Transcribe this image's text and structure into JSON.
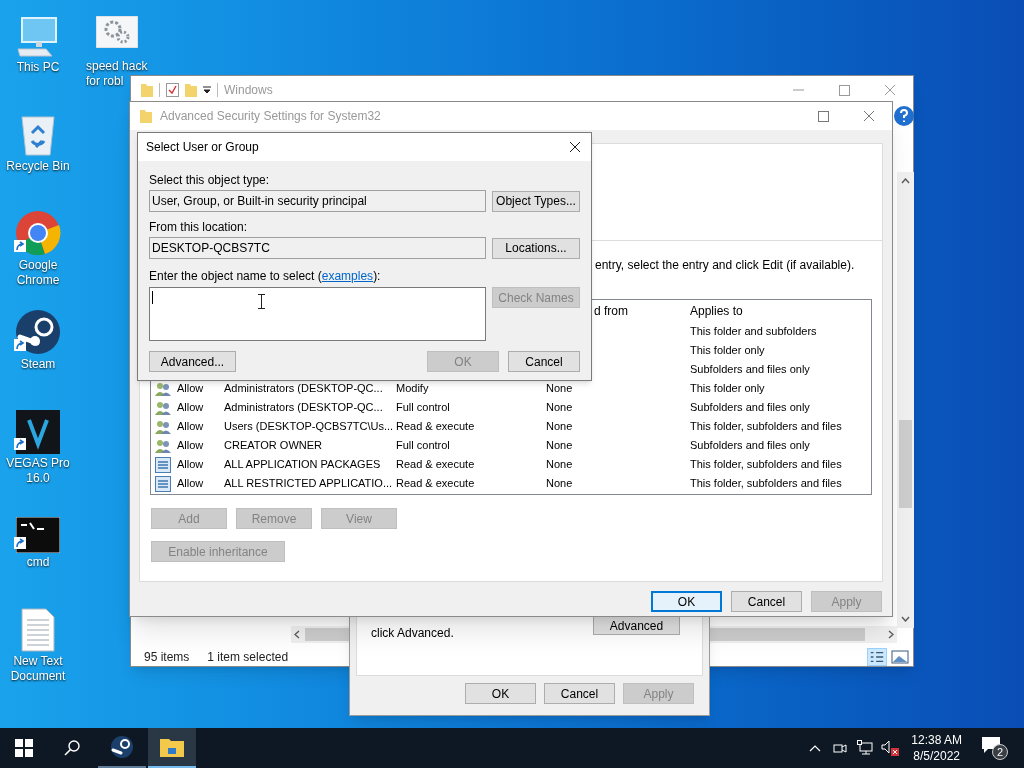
{
  "desktop": {
    "icons": [
      {
        "label": "This PC",
        "kind": "pc"
      },
      {
        "label": "Recycle Bin",
        "kind": "recycle"
      },
      {
        "label": "Google Chrome",
        "kind": "chrome",
        "shortcut": true
      },
      {
        "label": "Steam",
        "kind": "steam",
        "shortcut": true
      },
      {
        "label": "VEGAS Pro 16.0",
        "kind": "vegas",
        "shortcut": true
      },
      {
        "label": "cmd",
        "kind": "cmd",
        "shortcut": true
      },
      {
        "label": "New Text Document",
        "kind": "text"
      }
    ],
    "second_column": [
      {
        "label": "speed hack for robl",
        "kind": "settings"
      }
    ]
  },
  "explorer": {
    "title": "Windows",
    "status_items": "95 items",
    "status_selected": "1 item selected"
  },
  "properties": {
    "text": "click Advanced.",
    "advanced_button": "Advanced",
    "buttons": [
      {
        "label": "OK",
        "disabled": false
      },
      {
        "label": "Cancel",
        "disabled": false
      },
      {
        "label": "Apply",
        "disabled": true
      }
    ]
  },
  "advanced_security": {
    "title": "Advanced Security Settings for System32",
    "instruction": "entry, select the entry and click Edit (if available).",
    "columns": [
      "d from",
      "Applies to"
    ],
    "rows": [
      {
        "applies_to": "This folder and subfolders"
      },
      {
        "applies_to": "This folder only"
      },
      {
        "applies_to": "Subfolders and files only"
      },
      {
        "kind": "group",
        "type": "Allow",
        "principal": "Administrators (DESKTOP-QC...",
        "access": "Modify",
        "inherited": "None",
        "applies_to": "This folder only"
      },
      {
        "kind": "group",
        "type": "Allow",
        "principal": "Administrators (DESKTOP-QC...",
        "access": "Full control",
        "inherited": "None",
        "applies_to": "Subfolders and files only"
      },
      {
        "kind": "group",
        "type": "Allow",
        "principal": "Users (DESKTOP-QCBS7TC\\Us...",
        "access": "Read & execute",
        "inherited": "None",
        "applies_to": "This folder, subfolders and files"
      },
      {
        "kind": "group",
        "type": "Allow",
        "principal": "CREATOR OWNER",
        "access": "Full control",
        "inherited": "None",
        "applies_to": "Subfolders and files only"
      },
      {
        "kind": "package",
        "type": "Allow",
        "principal": "ALL APPLICATION PACKAGES",
        "access": "Read & execute",
        "inherited": "None",
        "applies_to": "This folder, subfolders and files"
      },
      {
        "kind": "package",
        "type": "Allow",
        "principal": "ALL RESTRICTED APPLICATIO...",
        "access": "Read & execute",
        "inherited": "None",
        "applies_to": "This folder, subfolders and files"
      }
    ],
    "action_buttons": [
      {
        "label": "Add",
        "disabled": true
      },
      {
        "label": "Remove",
        "disabled": true
      },
      {
        "label": "View",
        "disabled": true
      }
    ],
    "inheritance_button": {
      "label": "Enable inheritance",
      "disabled": true
    },
    "buttons": [
      {
        "label": "OK",
        "disabled": false,
        "focused": true
      },
      {
        "label": "Cancel",
        "disabled": false,
        "focused": false
      },
      {
        "label": "Apply",
        "disabled": true,
        "focused": false
      }
    ]
  },
  "dialog": {
    "title": "Select User or Group",
    "object_type_label": "Select this object type:",
    "object_type_value": "User, Group, or Built-in security principal",
    "object_types_button": "Object Types...",
    "location_label": "From this location:",
    "location_value": "DESKTOP-QCBS7TC",
    "locations_button": "Locations...",
    "name_label_before": "Enter the object name to select (",
    "name_label_link": "examples",
    "name_label_after": "):",
    "check_names": {
      "label": "Check Names",
      "disabled": true
    },
    "advanced_button": "Advanced...",
    "ok": {
      "label": "OK",
      "disabled": true
    },
    "cancel": {
      "label": "Cancel",
      "disabled": false
    }
  },
  "taskbar": {
    "apps": [
      {
        "kind": "steam",
        "selected": false
      },
      {
        "kind": "explorer",
        "selected": true
      }
    ],
    "time": "12:38 AM",
    "date": "8/5/2022",
    "notifications": "2"
  }
}
